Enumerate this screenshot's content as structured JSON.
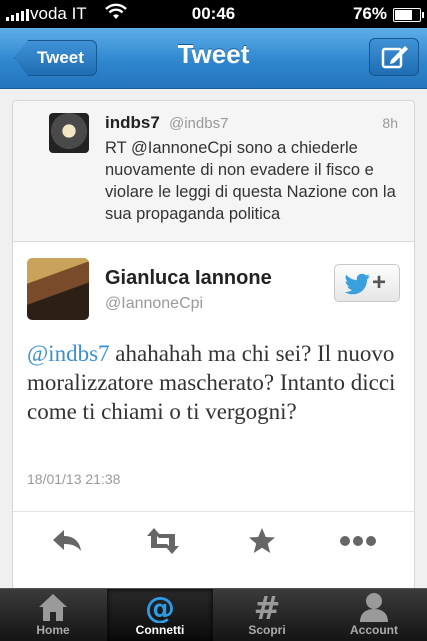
{
  "status_bar": {
    "carrier": "voda IT",
    "time": "00:46",
    "battery": "76%",
    "battery_level": 0.76
  },
  "nav": {
    "back_label": "Tweet",
    "title": "Tweet",
    "compose_icon": "compose-icon"
  },
  "quoted_tweet": {
    "name": "indbs7",
    "handle": "@indbs7",
    "time": "8h",
    "text": "RT @IannoneCpi sono a chiederle nuovamente di non evadere il fisco e violare le leggi di questa Nazione con la sua propaganda politica"
  },
  "tweet": {
    "author_name": "Gianluca Iannone",
    "author_handle": "@IannoneCpi",
    "mention": "@indbs7",
    "text": " ahahahah ma chi sei? Il nuovo moralizzatore mascherato? Intanto dicci come ti chiami o ti vergogni?",
    "date": "18/01/13 21:38",
    "follow_icon": "twitter-bird-icon"
  },
  "actions": [
    "reply-icon",
    "retweet-icon",
    "favorite-icon",
    "more-icon"
  ],
  "tabbar": {
    "tabs": [
      {
        "label": "Home",
        "icon": "home-icon"
      },
      {
        "label": "Connetti",
        "icon": "at-icon"
      },
      {
        "label": "Scopri",
        "icon": "hash-icon"
      },
      {
        "label": "Account",
        "icon": "account-icon"
      }
    ]
  },
  "colors": {
    "nav_blue": "#2f87cf",
    "mention_blue": "#3a8fd0",
    "tabbar_dark": "#141414"
  }
}
